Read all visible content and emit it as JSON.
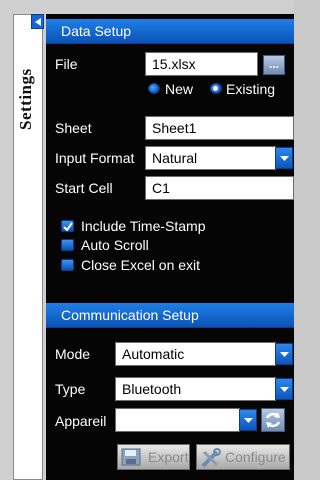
{
  "window": {
    "side_tab_title": "Settings"
  },
  "data_setup": {
    "header": "Data Setup",
    "file_label": "File",
    "file_value": "15.xlsx",
    "browse_label": "...",
    "file_mode": {
      "options": [
        "New",
        "Existing"
      ],
      "selected": "Existing"
    },
    "sheet_label": "Sheet",
    "sheet_value": "Sheet1",
    "input_format_label": "Input Format",
    "input_format_value": "Natural",
    "start_cell_label": "Start Cell",
    "start_cell_value": "C1",
    "checkboxes": [
      {
        "label": "Include Time-Stamp",
        "checked": true
      },
      {
        "label": "Auto Scroll",
        "checked": false
      },
      {
        "label": "Close Excel on exit",
        "checked": false
      }
    ]
  },
  "communication_setup": {
    "header": "Communication Setup",
    "mode_label": "Mode",
    "mode_value": "Automatic",
    "type_label": "Type",
    "type_value": "Bluetooth",
    "device_label": "Appareil",
    "device_value": ""
  },
  "toolbar": {
    "export_label": "Export",
    "configure_label": "Configure"
  },
  "colors": {
    "panel_bg": "#050505",
    "header_blue": "#1a6fd8",
    "accent_blue": "#0b53b6"
  }
}
